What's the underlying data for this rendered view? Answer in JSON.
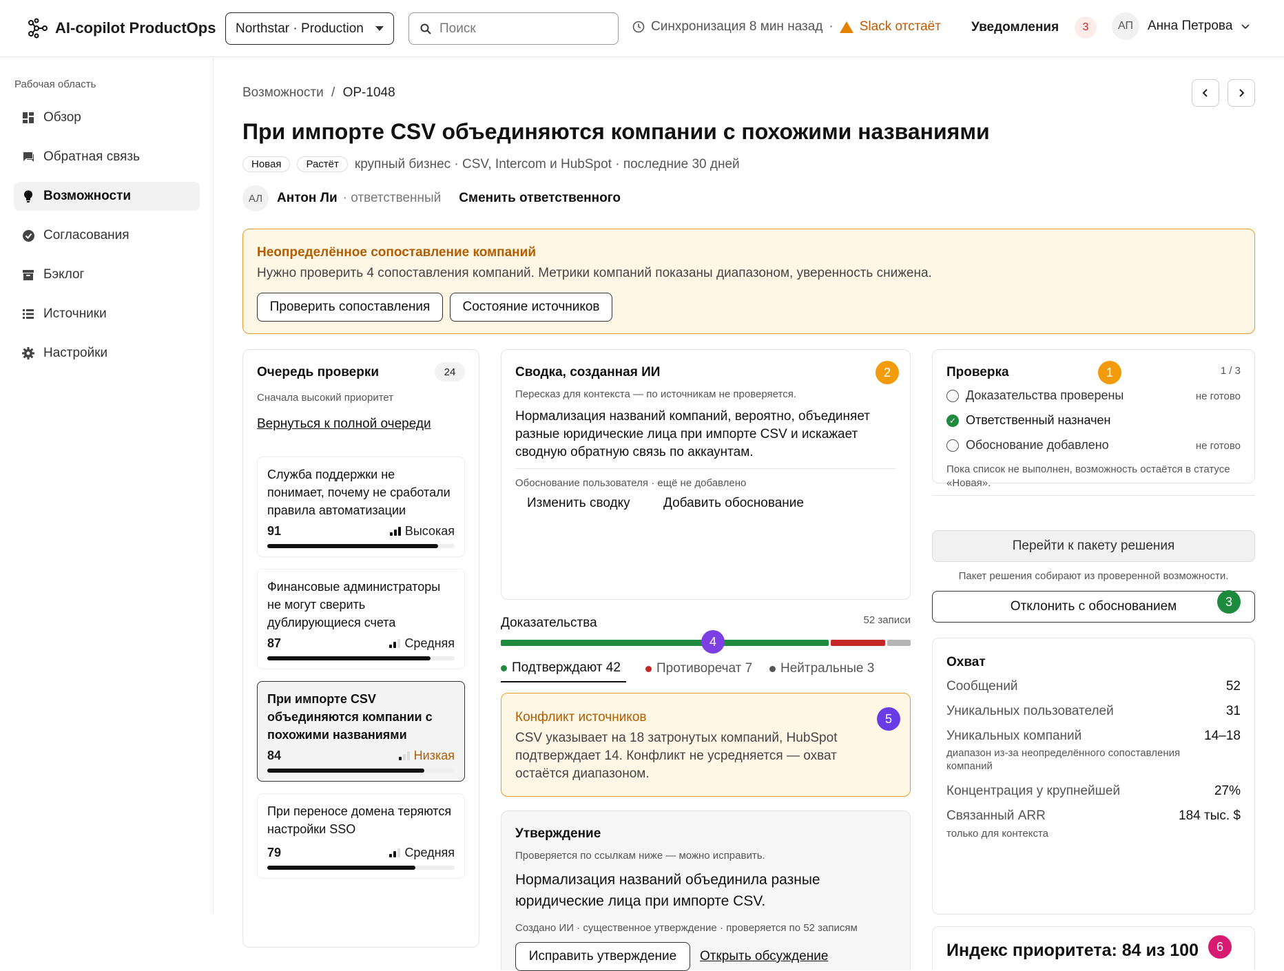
{
  "header": {
    "app_name": "AI-copilot ProductOps",
    "workspace": "Northstar · Production",
    "search_placeholder": "Поиск",
    "sync": "Синхронизация 8 мин назад",
    "sync_sep": "·",
    "slack_status": "Slack отстаёт",
    "notifications": "Уведомления",
    "notifications_count": "3",
    "user_initials": "АП",
    "user_name": "Анна Петрова"
  },
  "sidebar": {
    "section": "Рабочая область",
    "items": [
      {
        "label": "Обзор",
        "icon": "dashboard-icon"
      },
      {
        "label": "Обратная связь",
        "icon": "chat-icon"
      },
      {
        "label": "Возможности",
        "icon": "lightbulb-icon",
        "active": true
      },
      {
        "label": "Согласования",
        "icon": "check-circle-icon"
      },
      {
        "label": "Бэклог",
        "icon": "archive-icon"
      },
      {
        "label": "Источники",
        "icon": "list-icon"
      },
      {
        "label": "Настройки",
        "icon": "gear-icon"
      }
    ]
  },
  "page": {
    "breadcrumb_parent": "Возможности",
    "breadcrumb_sep": "/",
    "breadcrumb_current": "OP-1048",
    "title": "При импорте CSV объединяются компании с похожими названиями",
    "tags": [
      "Новая",
      "Растёт"
    ],
    "meta": "крупный бизнес · CSV, Intercom и HubSpot · последние 30 дней",
    "owner_initials": "АЛ",
    "owner_name": "Антон Ли",
    "owner_role": "· ответственный",
    "change_owner": "Сменить ответственного"
  },
  "alert": {
    "title": "Неопределённое сопоставление компаний",
    "text": "Нужно проверить 4 сопоставления компаний. Метрики компаний показаны диапазоном, уверенность снижена.",
    "btn_review": "Проверить сопоставления",
    "btn_sources": "Состояние источников"
  },
  "queue": {
    "title": "Очередь проверки",
    "count": "24",
    "subtitle": "Сначала высокий приоритет",
    "back": "Вернуться к полной очереди",
    "items": [
      {
        "title": "Служба поддержки не понимает, почему не сработали правила автоматизации",
        "score": "91",
        "priority": "Высокая",
        "fill": 0.91,
        "level": 3
      },
      {
        "title": "Финансовые администраторы не могут сверить дублирующиеся счета",
        "score": "87",
        "priority": "Средняя",
        "fill": 0.87,
        "level": 2
      },
      {
        "title": "При импорте CSV объединяются компании с похожими названиями",
        "score": "84",
        "priority": "Низкая",
        "fill": 0.84,
        "level": 1
      },
      {
        "title": "При переносе домена теряются настройки SSO",
        "score": "79",
        "priority": "Средняя",
        "fill": 0.79,
        "level": 2
      }
    ]
  },
  "summary": {
    "title": "Сводка, созданная ИИ",
    "badge": "2",
    "note": "Пересказ для контекста — по источникам не проверяется.",
    "text": "Нормализация названий компаний, вероятно, объединяет разные юридические лица при импорте CSV и искажает сводную обратную связь по аккаунтам.",
    "reason": "Обоснование пользователя · ещё не добавлено",
    "btn_edit": "Изменить сводку",
    "btn_add": "Добавить обоснование"
  },
  "evidence": {
    "title": "Доказательства",
    "total": "52 записи",
    "badge": "4",
    "support_label": "Подтверждают 42",
    "contra_label": "Противоречат 7",
    "neutral_label": "Нейтральные 3",
    "support": 42,
    "contra": 7,
    "neutral": 3,
    "support_color": "#1e8a3e",
    "contra_color": "#c62828",
    "neutral_color": "#b5b5b5"
  },
  "conflict": {
    "title": "Конфликт источников",
    "badge": "5",
    "text": "CSV указывает на 18 затронутых компаний, HubSpot подтверждает 14. Конфликт не усредняется — охват остаётся диапазоном."
  },
  "claim": {
    "title": "Утверждение",
    "note": "Проверяется по ссылкам ниже — можно исправить.",
    "text": "Нормализация названий объединила разные юридические лица при импорте CSV.",
    "meta": "Создано ИИ · существенное утверждение · проверяется по 52 записям",
    "btn_fix": "Исправить утверждение",
    "link_discuss": "Открыть обсуждение"
  },
  "review": {
    "title": "Проверка",
    "badge": "1",
    "progress": "1 / 3",
    "items": [
      {
        "label": "Доказательства проверены",
        "status": "не готово",
        "done": false
      },
      {
        "label": "Ответственный назначен",
        "status": "",
        "done": true
      },
      {
        "label": "Обоснование добавлено",
        "status": "не готово",
        "done": false
      }
    ],
    "note": "Пока список не выполнен, возможность остаётся в статусе «Новая»."
  },
  "decision": {
    "btn_go": "Перейти к пакету решения",
    "note": "Пакет решения собирают из проверенной возможности.",
    "btn_reject": "Отклонить с обоснованием",
    "badge": "3"
  },
  "reach": {
    "title": "Охват",
    "messages_label": "Сообщений",
    "messages": "52",
    "users_label": "Уникальных пользователей",
    "users": "31",
    "companies_label": "Уникальных компаний",
    "companies": "14–18",
    "companies_note": "диапазон из-за неопределённого сопоставления компаний",
    "conc_label": "Концентрация у крупнейшей",
    "conc": "27%",
    "arr_label": "Связанный ARR",
    "arr": "184 тыс. $",
    "arr_note": "только для контекста"
  },
  "priority": {
    "title": "Индекс приоритета: 84 из 100",
    "badge": "6"
  },
  "colors": {
    "orange": "#f29b0c",
    "green": "#1e8a3e",
    "purple": "#7b3fe4",
    "violet": "#6a3ce8",
    "pink": "#d81b72"
  }
}
